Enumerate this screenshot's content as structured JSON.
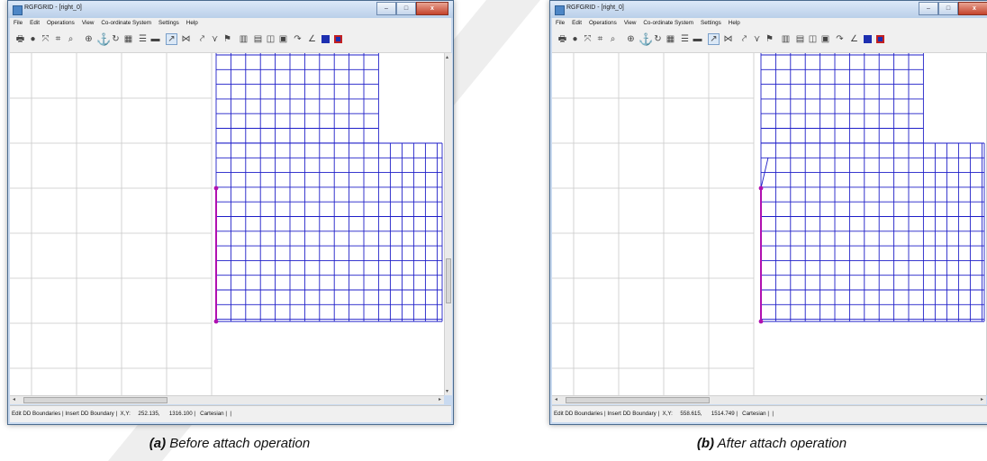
{
  "panels": [
    {
      "window_title": "RGFGRID - [right_0]",
      "menu": [
        "File",
        "Edit",
        "Operations",
        "View",
        "Co-ordinate System",
        "Settings",
        "Help"
      ],
      "status_text": "Edit DD Boundaries | Insert DD Boundary |  X,Y:     252.135,      1316.100 |   Cartesian |  |",
      "caption_label": "(a)",
      "caption_text": " Before attach operation",
      "attach_state": "before"
    },
    {
      "window_title": "RGFGRID - [right_0]",
      "menu": [
        "File",
        "Edit",
        "Operations",
        "View",
        "Co-ordinate System",
        "Settings",
        "Help"
      ],
      "status_text": "Edit DD Boundaries | Insert DD Boundary |  X,Y:     558.615,      1514.749 |   Cartesian |  |",
      "caption_label": "(b)",
      "caption_text": " After attach operation",
      "attach_state": "after"
    }
  ],
  "toolbar_icons": [
    "print-icon",
    "globe-icon",
    "zoom-extent-icon",
    "zoom-box-icon",
    "magnifier-icon",
    "target-icon",
    "anchor-icon",
    "refresh-icon",
    "grid-select-icon",
    "list-icon",
    "layers-icon",
    "draw-spline-icon",
    "cross-icon",
    "spline-icon",
    "branch-icon",
    "flag-icon",
    "matrix-icon",
    "refine-icon",
    "split-icon",
    "snap-icon",
    "orthogonalise-icon",
    "measure-icon",
    "color-blue-icon",
    "color-red-icon"
  ],
  "window_buttons": {
    "minimize": "–",
    "maximize": "□",
    "close": "x"
  },
  "colors": {
    "grid_blue": "#1e1ec8",
    "boundary_magenta": "#b010b0",
    "background_grid": "#c8c8c8",
    "watermark": "#ececec"
  }
}
